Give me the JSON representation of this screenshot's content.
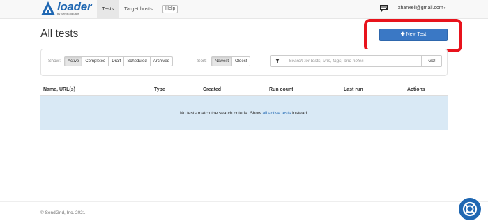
{
  "brand": {
    "name": "loader",
    "tagline": "by SendGrid Labs",
    "color": "#1f67b2"
  },
  "nav": {
    "tabs": [
      {
        "label": "Tests",
        "active": true
      },
      {
        "label": "Target hosts",
        "active": false
      }
    ],
    "help": "Help",
    "user_email": "xhanxeli@gmail.com",
    "user_caret": "▾"
  },
  "page": {
    "title": "All tests"
  },
  "toolbar": {
    "new_test_icon": "plus-icon",
    "new_test_label": "New Test"
  },
  "filters": {
    "show_label": "Show:",
    "show_options": [
      {
        "label": "Active",
        "selected": true
      },
      {
        "label": "Completed",
        "selected": false
      },
      {
        "label": "Draft",
        "selected": false
      },
      {
        "label": "Scheduled",
        "selected": false
      },
      {
        "label": "Archived",
        "selected": false
      }
    ],
    "sort_label": "Sort:",
    "sort_options": [
      {
        "label": "Newest",
        "selected": true
      },
      {
        "label": "Oldest",
        "selected": false
      }
    ],
    "search_placeholder": "Search for tests, urls, tags, and notes",
    "search_value": "",
    "go_label": "Go!"
  },
  "table": {
    "columns": [
      "Name, URL(s)",
      "Type",
      "Created",
      "Run count",
      "Last run",
      "Actions"
    ],
    "empty_prefix": "No tests match the search criteria. Show ",
    "empty_link": "all active tests",
    "empty_suffix": " instead."
  },
  "footer": {
    "copyright": "© SendGrid, Inc. 2021"
  },
  "colors": {
    "accent": "#3a78c5",
    "highlight": "#e8131c",
    "empty_row": "#d9e9f5"
  }
}
